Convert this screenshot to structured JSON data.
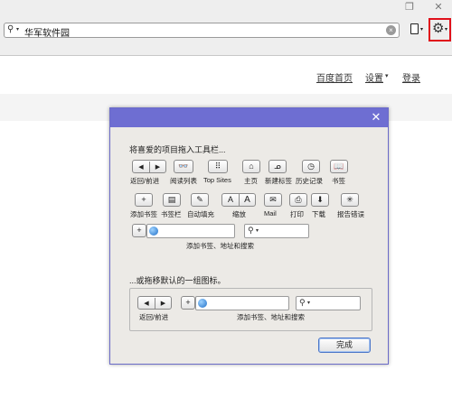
{
  "window": {
    "restore_icon": "❐",
    "close_icon": "✕"
  },
  "address_bar": {
    "search_icon": "⚲",
    "query": "华军软件园",
    "clear_icon": "×"
  },
  "toolbar": {
    "caret": "▾",
    "gear_icon": "⚙"
  },
  "topnav": {
    "home": "百度首页",
    "settings": "设置",
    "settings_caret": "▾",
    "login": "登录"
  },
  "dialog": {
    "close_icon": "✕",
    "instruction": "将喜爱的项目拖入工具栏...",
    "items": [
      {
        "id": "back-forward",
        "icon_left": "◀",
        "icon_right": "▶",
        "label": "返回/前进"
      },
      {
        "id": "reading-list",
        "icon": "👓",
        "label": "阅读列表"
      },
      {
        "id": "top-sites",
        "icon": "⠿",
        "label": "Top Sites"
      },
      {
        "id": "home",
        "icon": "⌂",
        "label": "主页"
      },
      {
        "id": "new-tab",
        "icon": "ᓄ",
        "label": "新建标签"
      },
      {
        "id": "history",
        "icon": "◷",
        "label": "历史记录"
      },
      {
        "id": "bookmarks",
        "icon": "📖",
        "label": "书签"
      },
      {
        "id": "add-bookmark",
        "icon": "+",
        "label": "添加书签"
      },
      {
        "id": "bookmarks-bar",
        "icon": "▤",
        "label": "书签栏"
      },
      {
        "id": "autofill",
        "icon": "✎",
        "label": "自动填充"
      },
      {
        "id": "zoom",
        "icon_left": "A",
        "icon_right": "A",
        "label": "缩放"
      },
      {
        "id": "mail",
        "icon": "✉",
        "label": "Mail"
      },
      {
        "id": "print",
        "icon": "⎙",
        "label": "打印"
      },
      {
        "id": "downloads",
        "icon": "⬇",
        "label": "下载"
      },
      {
        "id": "report-bug",
        "icon": "✳",
        "label": "报告错误"
      }
    ],
    "address_search_label": "添加书签、地址和搜索",
    "default_instruction": "...或拖移默认的一组图标。",
    "default_back_forward_label": "返回/前进",
    "default_address_search_label": "添加书签、地址和搜索",
    "done_label": "完成"
  }
}
